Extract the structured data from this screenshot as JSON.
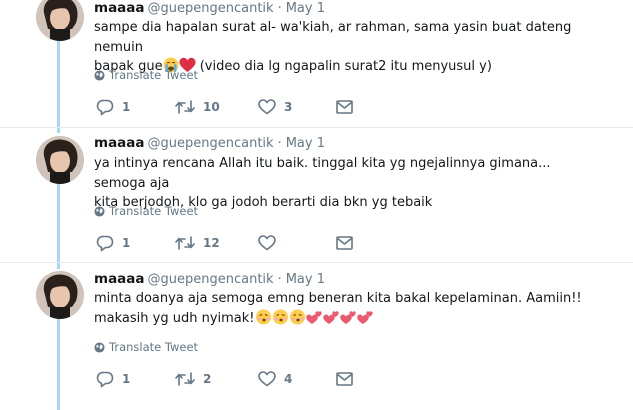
{
  "tweets": [
    {
      "display_name": "maaaa",
      "handle": "@guepengencantik",
      "separator": "·",
      "time": "May 1",
      "text_line1": "sampe dia hapalan surat al- wa'kiah, ar rahman, sama yasin buat dateng nemuin",
      "text_line2_prefix": "bapak gue",
      "text_line2_suffix": " (video dia lg ngapalin surat2 itu menyusul y)",
      "emojis": [
        "crying-face-emoji",
        "red-heart-emoji"
      ],
      "translate_label": "Translate Tweet",
      "replies": "1",
      "retweets": "10",
      "likes": "3"
    },
    {
      "display_name": "maaaa",
      "handle": "@guepengencantik",
      "separator": "·",
      "time": "May 1",
      "text_line1": "ya intinya rencana Allah itu baik. tinggal kita yg ngejalinnya gimana... semoga aja",
      "text_line2": "kita berjodoh, klo ga jodoh berarti dia bkn yg tebaik",
      "translate_label": "Translate Tweet",
      "replies": "1",
      "retweets": "12",
      "likes": ""
    },
    {
      "display_name": "maaaa",
      "handle": "@guepengencantik",
      "separator": "·",
      "time": "May 1",
      "text_line1": "minta doanya aja semoga emng beneran kita bakal kepelaminan. Aamiin!!",
      "text_line2_prefix": "makasih yg udh nyimak!",
      "emojis": [
        "kissing-face-emoji",
        "kissing-face-emoji",
        "kissing-face-emoji",
        "two-hearts-emoji",
        "two-hearts-emoji",
        "two-hearts-emoji",
        "two-hearts-emoji"
      ],
      "translate_label": "Translate Tweet",
      "replies": "1",
      "retweets": "2",
      "likes": "4"
    }
  ],
  "icons": {
    "reply": "reply-icon",
    "retweet": "retweet-icon",
    "like": "heart-icon",
    "dm": "envelope-icon",
    "translate": "globe-icon"
  },
  "colors": {
    "thread_line": "#a9d6f3",
    "secondary_text": "#657786",
    "primary_text": "#14171a",
    "divider": "#e6ecf0"
  }
}
